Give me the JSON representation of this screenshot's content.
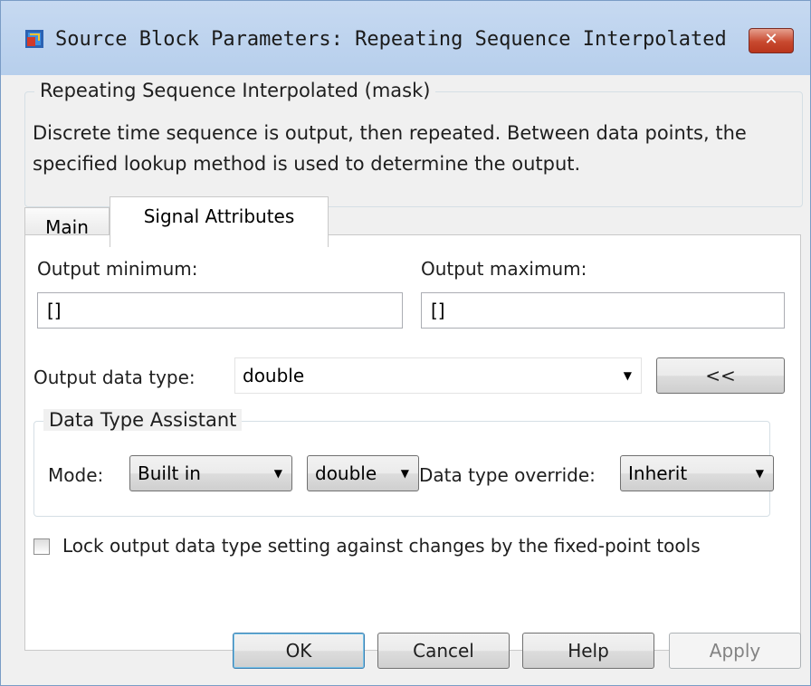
{
  "window": {
    "title": "Source Block Parameters: Repeating Sequence Interpolated",
    "icon": "simulink-block-icon",
    "close_label": "✕"
  },
  "mask_group": {
    "legend": "Repeating Sequence Interpolated (mask)",
    "description": "Discrete time sequence is output, then repeated.  Between data points, the specified lookup method is used to determine the output."
  },
  "tabs": [
    {
      "label": "Main",
      "active": false
    },
    {
      "label": "Signal Attributes",
      "active": true
    }
  ],
  "signal_attributes": {
    "output_minimum_label": "Output minimum:",
    "output_minimum_value": "[]",
    "output_maximum_label": "Output maximum:",
    "output_maximum_value": "[]",
    "output_data_type_label": "Output data type:",
    "output_data_type_value": "double",
    "assistant_toggle_label": "<<",
    "assistant": {
      "legend": "Data Type Assistant",
      "mode_label": "Mode:",
      "mode_value": "Built in",
      "type_value": "double",
      "override_label": "Data type override:",
      "override_value": "Inherit"
    },
    "lock_label": "Lock output data type setting against changes by the fixed-point tools",
    "lock_checked": false
  },
  "buttons": {
    "ok": "OK",
    "cancel": "Cancel",
    "help": "Help",
    "apply": "Apply"
  }
}
